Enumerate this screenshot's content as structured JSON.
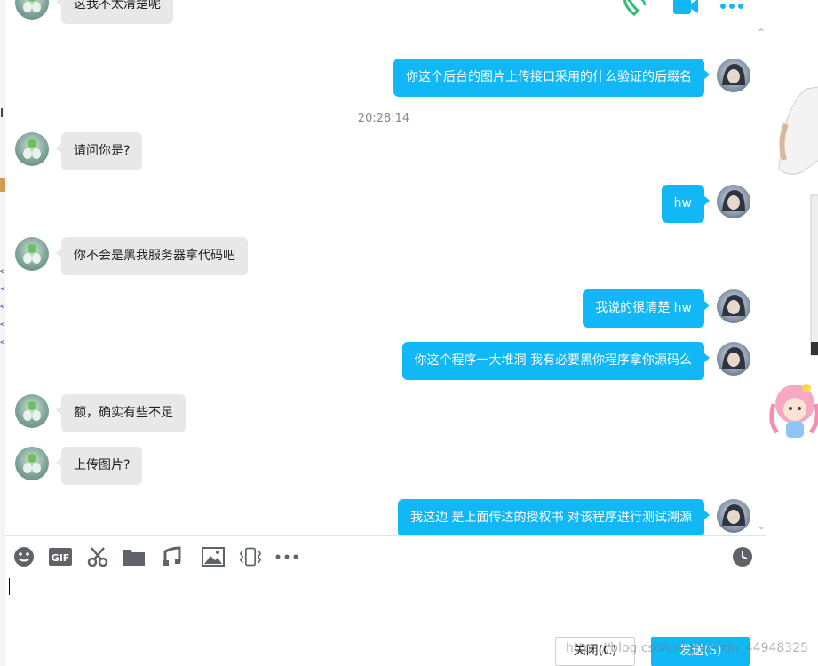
{
  "header": {
    "icons": [
      "voice-call-icon",
      "video-call-icon",
      "more-icon"
    ]
  },
  "chat": {
    "timestamp": "20:28:14",
    "messages": [
      {
        "from": "them",
        "text": "这我不太清楚呢"
      },
      {
        "from": "me",
        "text": "你这个后台的图片上传接口采用的什么验证的后缀名"
      },
      {
        "from": "them",
        "text": "请问你是?"
      },
      {
        "from": "me",
        "text": "hw"
      },
      {
        "from": "them",
        "text": "你不会是黑我服务器拿代码吧"
      },
      {
        "from": "me",
        "text": "我说的很清楚  hw"
      },
      {
        "from": "me",
        "text": "你这个程序一大堆洞 我有必要黑你程序拿你源码么"
      },
      {
        "from": "them",
        "text": "额，确实有些不足"
      },
      {
        "from": "them",
        "text": "上传图片?"
      },
      {
        "from": "me",
        "text": "我这边 是上面传达的授权书  对该程序进行测试溯源"
      }
    ]
  },
  "toolbar": {
    "icons": [
      "emoji-icon",
      "gif-icon",
      "screenshot-scissors-icon",
      "folder-icon",
      "music-icon",
      "image-icon",
      "shake-icon",
      "more-icon",
      "history-clock-icon"
    ]
  },
  "input": {
    "value": ""
  },
  "buttons": {
    "close_label": "关闭(C)",
    "send_label": "发送(S)"
  },
  "watermark": "https://blog.csdn.net/weixin_44948325",
  "colors": {
    "accent": "#12b7f5",
    "incoming_bubble": "#e8e8e8"
  }
}
